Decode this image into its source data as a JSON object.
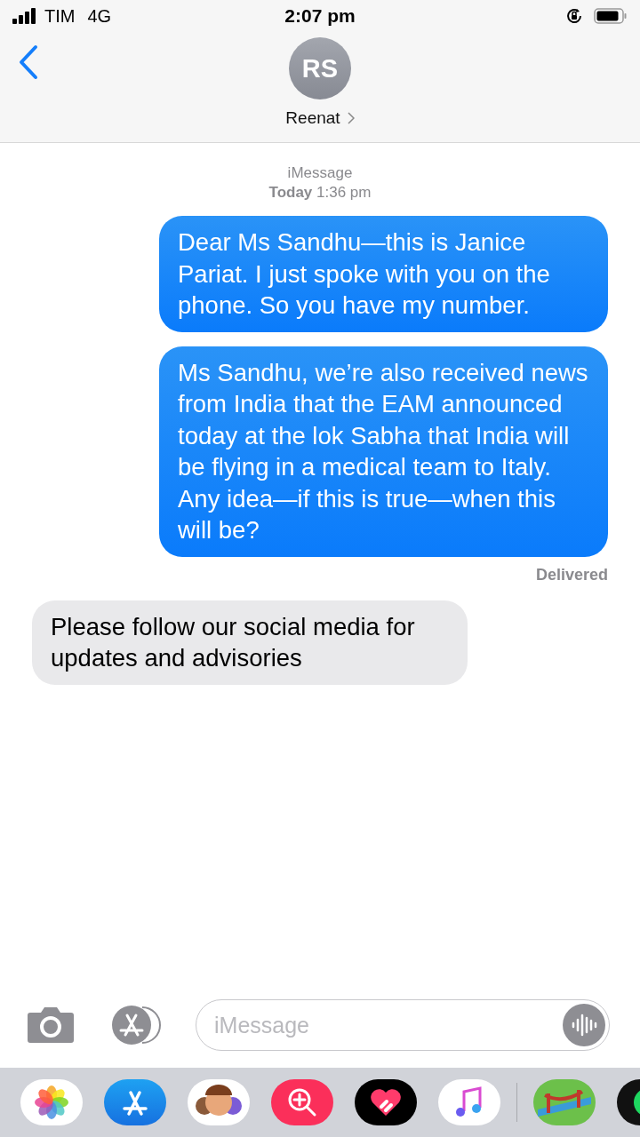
{
  "status_bar": {
    "carrier": "TIM",
    "network": "4G",
    "time": "2:07 pm"
  },
  "header": {
    "avatar_initials": "RS",
    "contact_name": "Reenat"
  },
  "thread": {
    "service": "iMessage",
    "timestamp": "**Today** 1:36 pm"
  },
  "messages": [
    {
      "kind": "sent",
      "text": "Dear Ms Sandhu—this is Janice Pariat. I just spoke with you on the phone. So you have my number."
    },
    {
      "kind": "sent",
      "text": "Ms Sandhu, we’re also received news from India that the EAM announced today at the lok Sabha that India will be flying in a medical team to Italy. Any idea—if this is true—when this will be?",
      "status": "Delivered"
    },
    {
      "kind": "received",
      "text": "Please follow our social media for updates and advisories"
    }
  ],
  "composer": {
    "placeholder": "iMessage"
  }
}
